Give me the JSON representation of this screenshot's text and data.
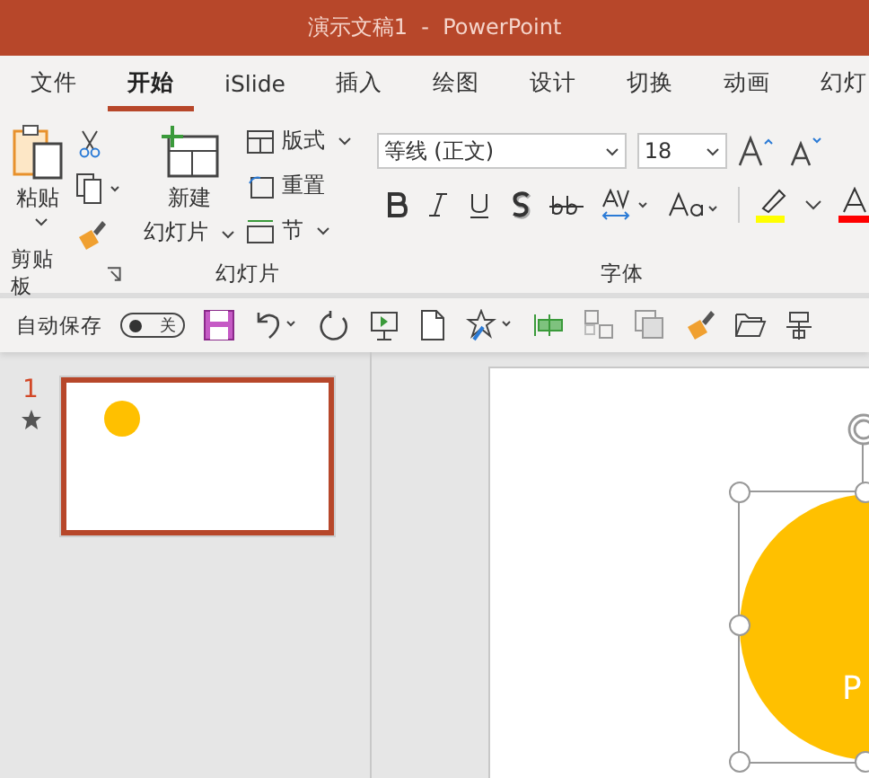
{
  "window": {
    "title": "演示文稿1  -  PowerPoint"
  },
  "tabs": [
    {
      "label": "文件",
      "selected": false
    },
    {
      "label": "开始",
      "selected": true
    },
    {
      "label": "iSlide",
      "selected": false
    },
    {
      "label": "插入",
      "selected": false
    },
    {
      "label": "绘图",
      "selected": false
    },
    {
      "label": "设计",
      "selected": false
    },
    {
      "label": "切换",
      "selected": false
    },
    {
      "label": "动画",
      "selected": false
    },
    {
      "label": "幻灯",
      "selected": false
    }
  ],
  "clipboard": {
    "paste": "粘贴",
    "label": "剪贴板"
  },
  "slides_group": {
    "new_slide": [
      "新建",
      "幻灯片"
    ],
    "layout": "版式",
    "reset": "重置",
    "section": "节",
    "label": "幻灯片"
  },
  "font_group": {
    "font_name": "等线 (正文)",
    "font_size": "18",
    "label": "字体"
  },
  "autosave": {
    "label": "自动保存",
    "on": false,
    "state_text": "关"
  },
  "slides": [
    {
      "number": "1",
      "selected": true,
      "animated": true
    }
  ],
  "canvas": {
    "shape_text": "P",
    "selected": true
  }
}
